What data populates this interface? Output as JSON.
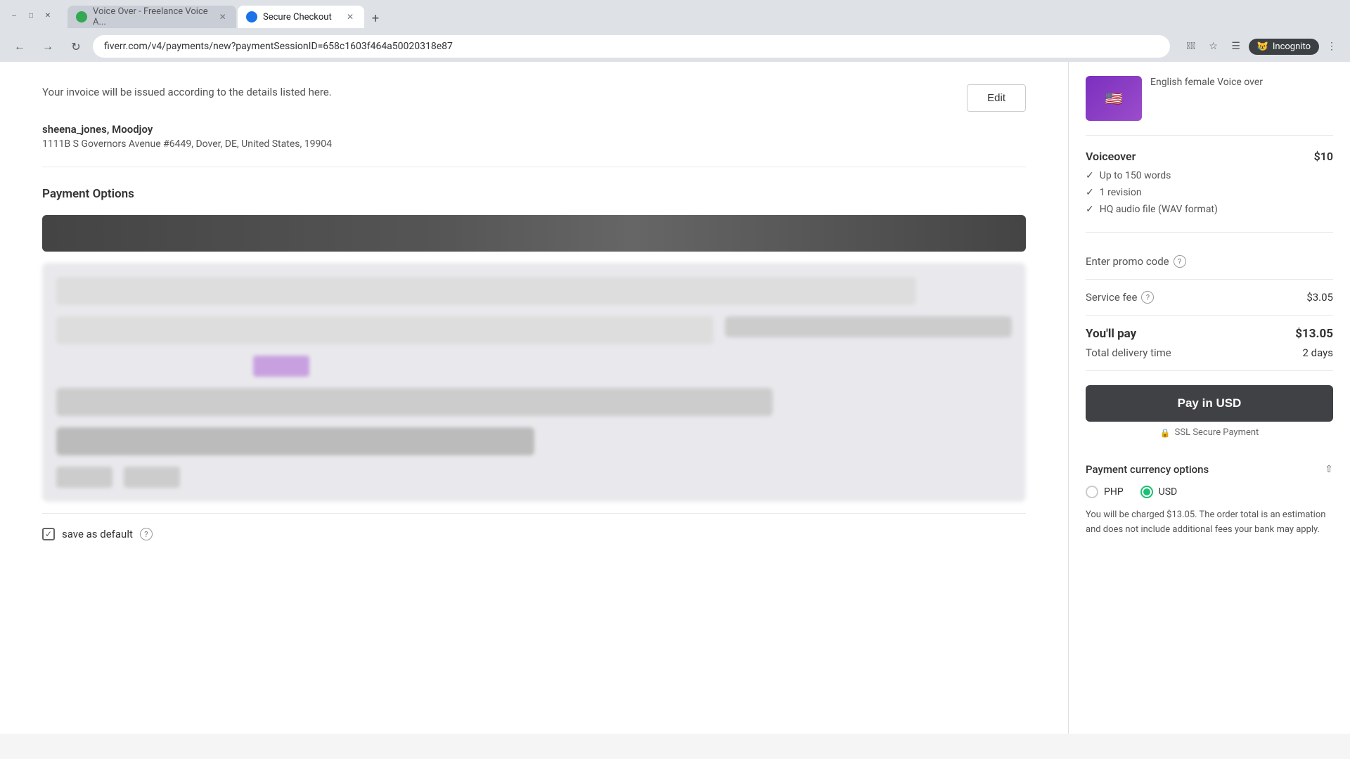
{
  "browser": {
    "url": "fiverr.com/v4/payments/new?paymentSessionID=658c1603f464a50020318e87",
    "tabs": [
      {
        "id": "tab1",
        "title": "Voice Over - Freelance Voice A...",
        "active": false,
        "favicon_color": "green"
      },
      {
        "id": "tab2",
        "title": "Secure Checkout",
        "active": true,
        "favicon_color": "blue"
      }
    ],
    "incognito_label": "Incognito"
  },
  "invoice": {
    "notice": "Your invoice will be issued according to the details listed here.",
    "edit_button": "Edit",
    "name": "sheena_jones, Moodjoy",
    "address": "1111B S Governors Avenue #6449, Dover, DE, United States, 19904"
  },
  "payment": {
    "section_title": "Payment Options",
    "save_as_default": "save as default"
  },
  "order_summary": {
    "service_title": "English female Voice over",
    "voiceover_label": "Voiceover",
    "voiceover_price": "$10",
    "features": [
      "Up to 150 words",
      "1 revision",
      "HQ audio file (WAV format)"
    ],
    "promo_label": "Enter promo code",
    "service_fee_label": "Service fee",
    "service_fee_amount": "$3.05",
    "youll_pay_label": "You'll pay",
    "youll_pay_amount": "$13.05",
    "delivery_label": "Total delivery time",
    "delivery_value": "2 days",
    "pay_button": "Pay in USD",
    "ssl_label": "SSL Secure Payment",
    "currency_title": "Payment currency options",
    "currency_options": [
      {
        "code": "PHP",
        "selected": false
      },
      {
        "code": "USD",
        "selected": true
      }
    ],
    "currency_note": "You will be charged $13.05. The order total is an estimation and does not include additional fees your bank may apply."
  }
}
